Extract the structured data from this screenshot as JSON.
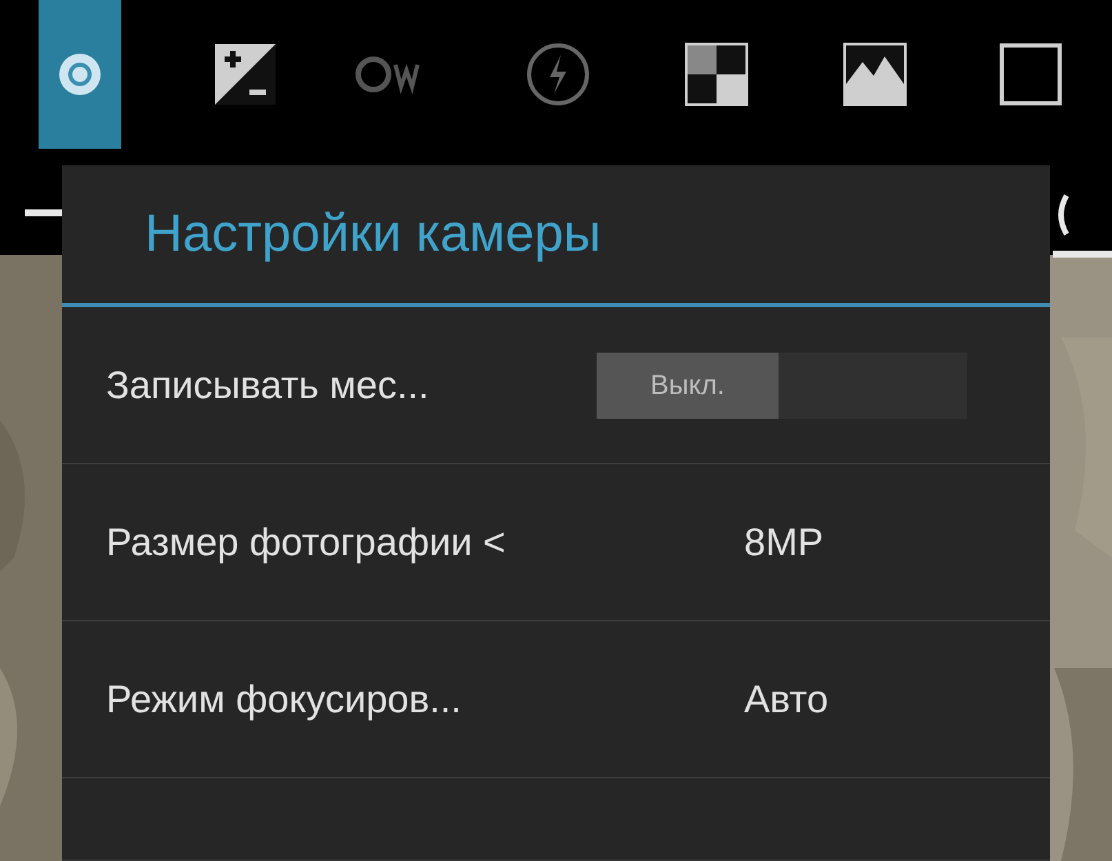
{
  "toolbar": [
    {
      "selected": true
    },
    {
      "selected": false
    },
    {
      "selected": false
    },
    {
      "selected": false
    },
    {
      "selected": false
    },
    {
      "selected": false
    },
    {
      "selected": false
    }
  ],
  "panel": {
    "title": "Настройки камеры",
    "rows": [
      {
        "kind": "toggle",
        "label": "Записывать мес...",
        "on": false,
        "value": "Выкл."
      },
      {
        "kind": "value",
        "label": "Размер фотографии <",
        "value": "8MP"
      },
      {
        "kind": "value",
        "label": "Режим фокусиров...",
        "value": "Авто"
      },
      {
        "kind": "cut"
      }
    ]
  }
}
